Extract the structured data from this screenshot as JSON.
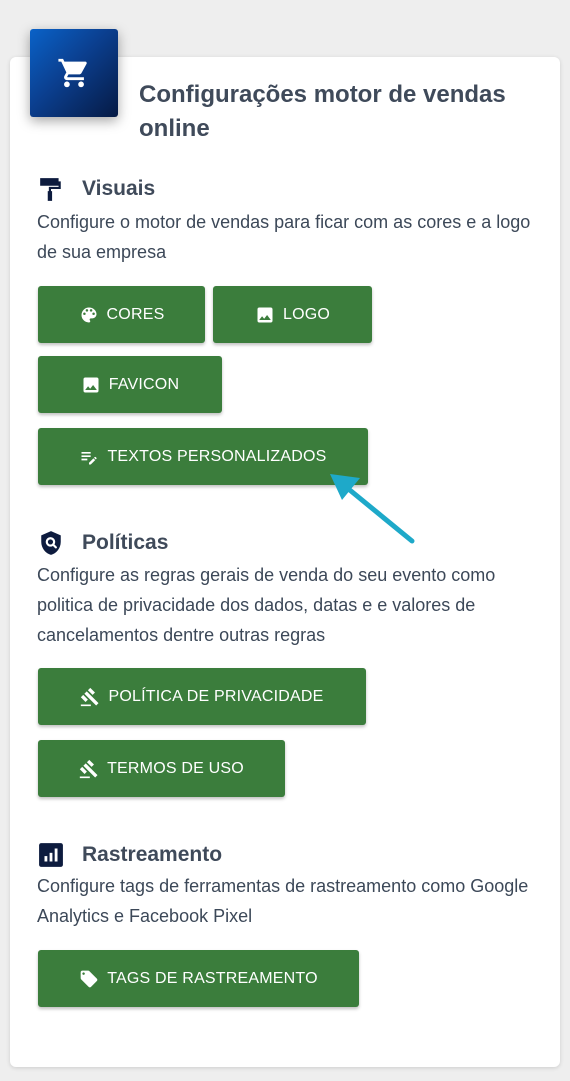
{
  "header": {
    "icon": "shopping-cart-icon",
    "title": "Configurações motor de vendas online"
  },
  "sections": {
    "visuais": {
      "icon": "paint-roller-icon",
      "title": "Visuais",
      "description": "Configure o motor de vendas para ficar com as cores e a logo de sua empresa",
      "buttons": {
        "cores": "CORES",
        "logo": "LOGO",
        "favicon": "FAVICON",
        "textos": "TEXTOS PERSONALIZADOS"
      }
    },
    "politicas": {
      "icon": "shield-search-icon",
      "title": "Políticas",
      "description": "Configure as regras gerais de venda do seu evento como politica de privacidade dos dados, datas e e valores de cancelamentos dentre outras regras",
      "buttons": {
        "privacidade": "POLÍTICA DE PRIVACIDADE",
        "termos": "TERMOS DE USO"
      }
    },
    "rastreamento": {
      "icon": "analytics-icon",
      "title": "Rastreamento",
      "description": "Configure tags de ferramentas de rastreamento como Google Analytics e Facebook Pixel",
      "buttons": {
        "tags": "TAGS DE RASTREAMENTO"
      }
    }
  },
  "colors": {
    "button_green": "#3b7d3c",
    "header_icon_blue": "#0b4ea8",
    "arrow_cyan": "#1ea9c9",
    "title_text": "#3f4a5a"
  }
}
